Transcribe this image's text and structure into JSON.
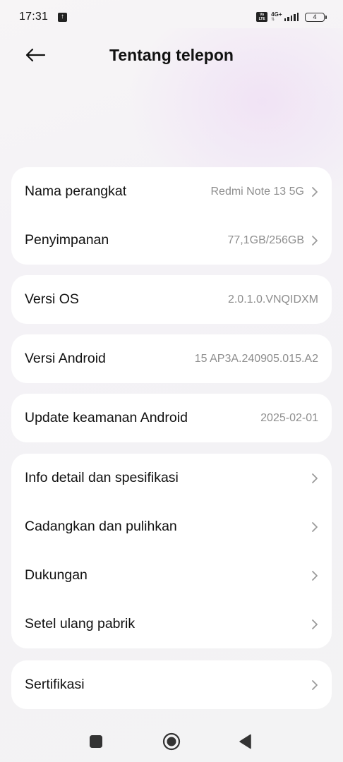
{
  "status_bar": {
    "time": "17:31",
    "volte_label": "Vo LTE",
    "network_label": "4G+",
    "battery_level": "4"
  },
  "header": {
    "title": "Tentang telepon"
  },
  "sections": [
    {
      "items": [
        {
          "label": "Nama perangkat",
          "value": "Redmi Note 13 5G",
          "chevron": true
        },
        {
          "label": "Penyimpanan",
          "value": "77,1GB/256GB",
          "chevron": true
        }
      ]
    },
    {
      "items": [
        {
          "label": "Versi OS",
          "value": "2.0.1.0.VNQIDXM",
          "chevron": false
        }
      ]
    },
    {
      "items": [
        {
          "label": "Versi Android",
          "value": "15 AP3A.240905.015.A2",
          "chevron": false
        }
      ]
    },
    {
      "items": [
        {
          "label": "Update keamanan Android",
          "value": "2025-02-01",
          "chevron": false
        }
      ]
    },
    {
      "items": [
        {
          "label": "Info detail dan spesifikasi",
          "chevron": true
        },
        {
          "label": "Cadangkan dan pulihkan",
          "chevron": true
        },
        {
          "label": "Dukungan",
          "chevron": true
        },
        {
          "label": "Setel ulang pabrik",
          "chevron": true
        }
      ]
    },
    {
      "items": [
        {
          "label": "Sertifikasi",
          "chevron": true
        }
      ]
    }
  ],
  "nav_bar": {
    "buttons": [
      "recents",
      "home",
      "back"
    ]
  },
  "colors": {
    "background": "#f3f2f5",
    "card": "#ffffff",
    "primary_text": "#111111",
    "secondary_text": "#8e8e8e",
    "chevron": "#9a9a9a"
  }
}
